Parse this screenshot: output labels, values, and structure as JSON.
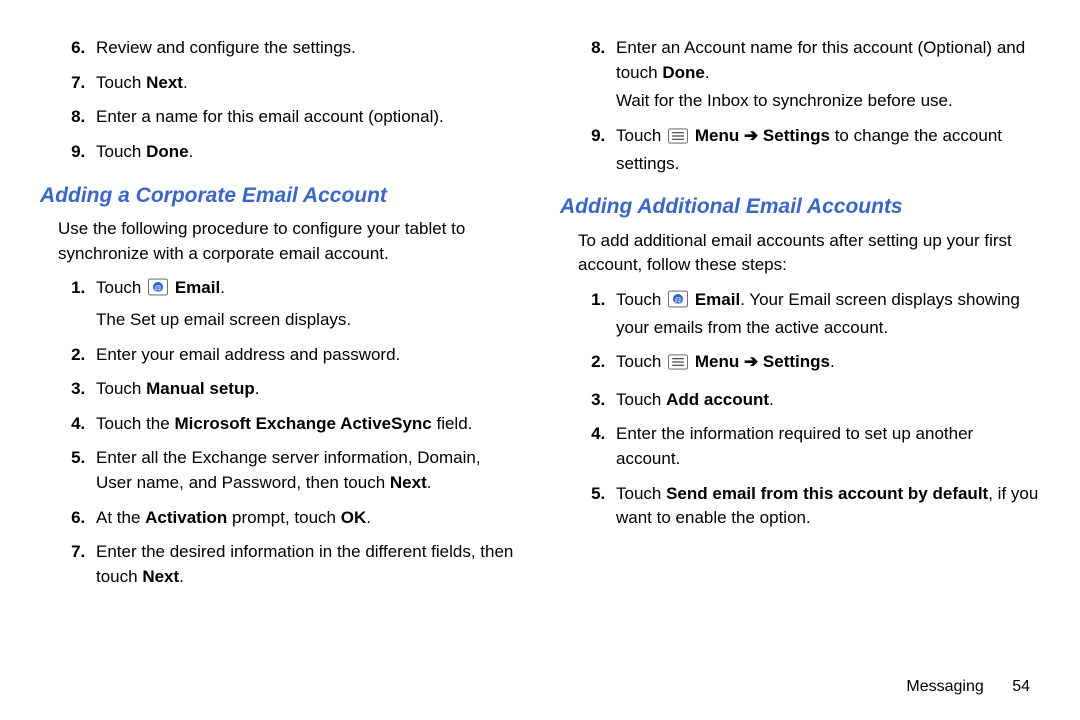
{
  "left": {
    "listA": {
      "start": 6,
      "items": [
        {
          "html": "Review and configure the settings."
        },
        {
          "html": "Touch <b>Next</b>."
        },
        {
          "html": "Enter a name for this email account (optional)."
        },
        {
          "html": "Touch <b>Done</b>."
        }
      ]
    },
    "heading1": "Adding a Corporate Email Account",
    "para1": "Use the following procedure to configure your tablet to synchronize with a corporate email account.",
    "listB": {
      "start": 1,
      "items": [
        {
          "html": "Touch {EMAIL_ICON} <b>Email</b>.<span class='sub'>The Set up email screen displays.</span>"
        },
        {
          "html": "Enter your email address and password."
        },
        {
          "html": "Touch <b>Manual setup</b>."
        },
        {
          "html": "Touch the <b>Microsoft Exchange ActiveSync</b> field."
        },
        {
          "html": "Enter all the Exchange server information, Domain, User name, and Password, then touch <b>Next</b>."
        },
        {
          "html": "At the <b>Activation</b> prompt, touch <b>OK</b>."
        },
        {
          "html": "Enter the desired information in the different fields, then touch <b>Next</b>."
        }
      ]
    }
  },
  "right": {
    "listC": {
      "start": 8,
      "items": [
        {
          "html": "Enter an Account name for this account (Optional) and touch <b>Done</b>.<span class='sub'>Wait for the Inbox to synchronize before use.</span>"
        },
        {
          "html": "Touch {MENU_ICON} <b>Menu <span class='arrow'>➔</span> Settings</b> to change the account settings."
        }
      ]
    },
    "heading2": "Adding Additional Email Accounts",
    "para2": "To add additional email accounts after setting up your first account, follow these steps:",
    "listD": {
      "start": 1,
      "items": [
        {
          "html": "Touch {EMAIL_ICON} <b>Email</b>. Your Email screen displays showing your emails from the active account."
        },
        {
          "html": "Touch {MENU_ICON} <b>Menu <span class='arrow'>➔</span> Settings</b>."
        },
        {
          "html": "Touch <b>Add account</b>."
        },
        {
          "html": "Enter the information required to set up another account."
        },
        {
          "html": "Touch <b>Send email from this account by default</b>, if you want to enable the option."
        }
      ]
    }
  },
  "footer": {
    "section": "Messaging",
    "page": "54"
  },
  "icons": {
    "email": "email-icon",
    "menu": "menu-icon"
  }
}
